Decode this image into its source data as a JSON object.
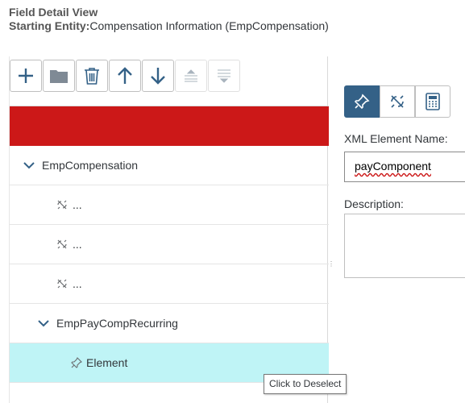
{
  "header": {
    "title": "Field Detail View",
    "entity_label": "Starting Entity:",
    "entity_value": "Compensation Information (EmpCompensation)"
  },
  "toolbar": {
    "buttons": [
      {
        "icon": "plus-icon",
        "enabled": true
      },
      {
        "icon": "folder-icon",
        "enabled": true
      },
      {
        "icon": "trash-icon",
        "enabled": true
      },
      {
        "icon": "arrow-up-icon",
        "enabled": true
      },
      {
        "icon": "arrow-down-icon",
        "enabled": true
      },
      {
        "icon": "collapse-icon",
        "enabled": false
      },
      {
        "icon": "expand-icon",
        "enabled": false
      }
    ]
  },
  "tree": {
    "rows": [
      {
        "label": "EmpCompensation",
        "type": "folder",
        "expanded": true
      },
      {
        "label": "...",
        "type": "unlinked"
      },
      {
        "label": "...",
        "type": "unlinked"
      },
      {
        "label": "...",
        "type": "unlinked"
      },
      {
        "label": "EmpPayCompRecurring",
        "type": "folder",
        "expanded": true
      },
      {
        "label": "Element",
        "type": "pinned",
        "selected": true
      }
    ]
  },
  "detail": {
    "mode_buttons": [
      {
        "icon": "pin-icon",
        "active": true
      },
      {
        "icon": "unlink-icon",
        "active": false
      },
      {
        "icon": "calculator-icon",
        "active": false
      }
    ],
    "xml_label": "XML Element Name:",
    "xml_value": "payComponent",
    "description_label": "Description:"
  },
  "tooltip": "Click to Deselect",
  "colors": {
    "accent": "#346187",
    "error_bar": "#cc1818",
    "selected_row": "#bff4f6",
    "icon": "#346187"
  }
}
